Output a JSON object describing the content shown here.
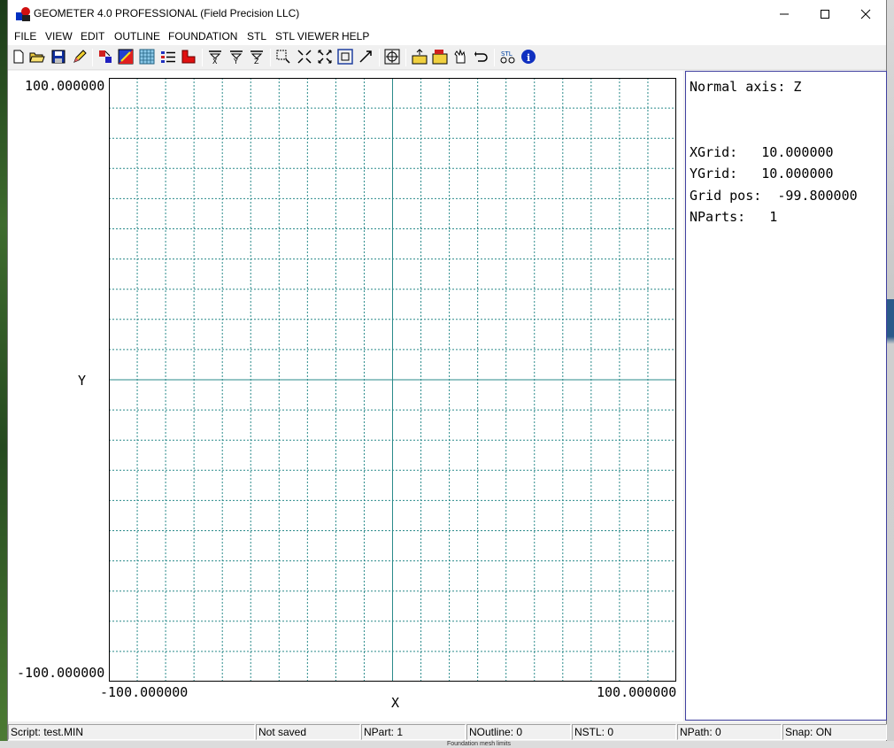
{
  "window": {
    "title": "GEOMETER 4.0 PROFESSIONAL (Field Precision LLC)"
  },
  "menu": [
    "FILE",
    "VIEW",
    "EDIT",
    "OUTLINE",
    "FOUNDATION",
    "STL",
    "STL VIEWER",
    "HELP"
  ],
  "toolbar": {
    "buttons": [
      "new-file-icon",
      "open-folder-icon",
      "save-icon",
      "pencil-icon",
      "parts-icon",
      "color-fill-icon",
      "grid-pattern-icon",
      "list-icon",
      "red-shape-icon",
      "filter-x-icon",
      "filter-y-icon",
      "filter-z-icon",
      "zoom-window-icon",
      "zoom-in-icon",
      "zoom-out-icon",
      "fit-view-icon",
      "pan-arrow-icon",
      "crosshair-icon",
      "folder-up-icon",
      "folder-yellow-icon",
      "hand-pointer-icon",
      "undo-icon",
      "stl-icon",
      "info-icon"
    ]
  },
  "plot": {
    "ymax_label": "100.000000",
    "ymin_label": "-100.000000",
    "xmin_label": "-100.000000",
    "xmax_label": "100.000000",
    "x_axis_label": "X",
    "y_axis_label": "Y",
    "xlim": [
      -100,
      100
    ],
    "ylim": [
      -100,
      100
    ],
    "grid_step": 10,
    "grid_color": "#2a8a8a"
  },
  "info": {
    "normal_axis": "Normal axis: Z",
    "xgrid": "XGrid:   10.000000",
    "ygrid": "YGrid:   10.000000",
    "grid_pos": "Grid pos:  -99.800000",
    "nparts": "NParts:   1"
  },
  "status": {
    "script": "Script: test.MIN",
    "saved": "Not saved",
    "npart": "NPart:   1",
    "noutline": "NOutline:  0",
    "nstl": "NSTL:   0",
    "npath": "NPath:  0",
    "snap": "Snap: ON"
  },
  "taskbar_hint": "Foundation mesh limits"
}
